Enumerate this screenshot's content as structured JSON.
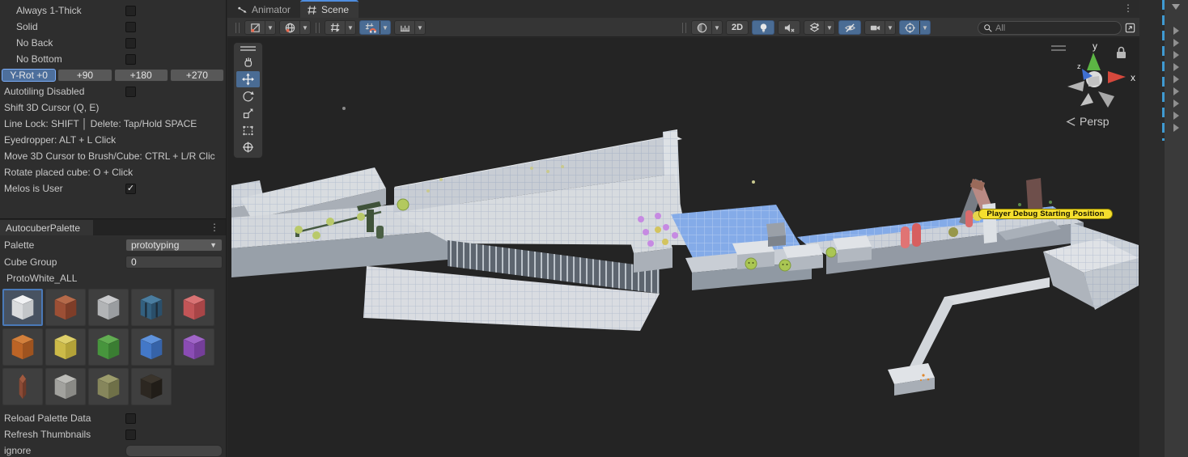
{
  "left_panel": {
    "toggles": [
      {
        "label": "Always 1-Thick",
        "checked": false
      },
      {
        "label": "Solid",
        "checked": false
      },
      {
        "label": "No Back",
        "checked": false
      },
      {
        "label": "No Bottom",
        "checked": false
      }
    ],
    "rotation_buttons": [
      {
        "label": "Y-Rot +0",
        "selected": true
      },
      {
        "label": "+90",
        "selected": false
      },
      {
        "label": "+180",
        "selected": false
      },
      {
        "label": "+270",
        "selected": false
      }
    ],
    "autotiling": {
      "label": "Autotiling Disabled",
      "checked": false
    },
    "hints": [
      "Shift 3D Cursor (Q, E)",
      "Line Lock: SHIFT │ Delete: Tap/Hold SPACE",
      "Eyedropper: ALT + L Click",
      "Move 3D Cursor to Brush/Cube: CTRL + L/R Clic",
      "Rotate placed cube: O + Click"
    ],
    "melos_toggle": {
      "label": "Melos is User",
      "checked": true
    }
  },
  "palette_panel": {
    "title": "AutocuberPalette",
    "rows": [
      {
        "label": "Palette",
        "value": "prototyping"
      },
      {
        "label": "Cube Group",
        "value": "0"
      }
    ],
    "group_name": "ProtoWhite_ALL",
    "swatches": [
      {
        "name": "proto-white",
        "top": "#f1f2f4",
        "left": "#d9dbdd",
        "right": "#c3c6c9",
        "selected": true
      },
      {
        "name": "rust-brown",
        "top": "#b56a4a",
        "left": "#9c4f35",
        "right": "#7e3d28"
      },
      {
        "name": "light-gray",
        "top": "#c9cacc",
        "left": "#b2b4b6",
        "right": "#9a9da0"
      },
      {
        "name": "navy-strapped",
        "top": "#4a7da0",
        "left": "#33607f",
        "right": "#2a4f6a",
        "straps": true
      },
      {
        "name": "red",
        "top": "#d97374",
        "left": "#c25557",
        "right": "#a84547"
      },
      {
        "name": "orange",
        "top": "#d3803c",
        "left": "#bc6426",
        "right": "#9e531f"
      },
      {
        "name": "yellow",
        "top": "#ded06a",
        "left": "#ccba48",
        "right": "#b3a238"
      },
      {
        "name": "green",
        "top": "#62ad52",
        "left": "#47953d",
        "right": "#3a7d32"
      },
      {
        "name": "blue",
        "top": "#5f93dd",
        "left": "#4378c8",
        "right": "#3663a8"
      },
      {
        "name": "purple",
        "top": "#a065c8",
        "left": "#8a4cb4",
        "right": "#743e99"
      },
      {
        "name": "thin-brown-slab",
        "top": "#a05a40",
        "left": "#8a4a35",
        "right": "#6e3a29",
        "variant": "slab"
      },
      {
        "name": "stone-gray",
        "top": "#bcbcb8",
        "left": "#a2a29e",
        "right": "#8a8a86"
      },
      {
        "name": "mossy-bark",
        "top": "#9c9c6c",
        "left": "#86865c",
        "right": "#6f7048"
      },
      {
        "name": "dark-rock",
        "top": "#3a342c",
        "left": "#2c2721",
        "right": "#211d18"
      }
    ],
    "footer": [
      {
        "label": "Reload Palette Data",
        "checked": false
      },
      {
        "label": "Refresh Thumbnails",
        "checked": false
      }
    ],
    "ignore_field": {
      "label": "ignore",
      "value": ""
    }
  },
  "tab_bar": {
    "tabs": [
      {
        "label": "Animator",
        "icon": "animator-icon",
        "active": false
      },
      {
        "label": "Scene",
        "icon": "scene-grid-icon",
        "active": true
      }
    ]
  },
  "toolbar": {
    "view_2d_label": "2D",
    "states": {
      "tool_pivot_active": false,
      "tool_rotation_active": false,
      "grid_visibility_active": false,
      "grid_snap_active": true,
      "increment_snap_active": false,
      "shading_active": false,
      "view_2d_active": false,
      "lighting_active": true,
      "audio_active": false,
      "effects_active": false,
      "hidden_objects_active": true,
      "camera_active": false,
      "gizmos_active": true
    },
    "search": {
      "placeholder": "All"
    }
  },
  "scene_view": {
    "tools": [
      {
        "name": "hand-tool",
        "active": false
      },
      {
        "name": "move-tool",
        "active": true
      },
      {
        "name": "rotate-tool",
        "active": false
      },
      {
        "name": "scale-tool",
        "active": false
      },
      {
        "name": "rect-tool",
        "active": false
      },
      {
        "name": "transform-tool",
        "active": false
      }
    ],
    "gizmo": {
      "axis_x": "x",
      "axis_y": "y",
      "axis_z": "z",
      "projection": "Persp"
    },
    "debug_label": "Player Debug Starting Position",
    "colors": {
      "water": "#84abe8",
      "terrain_light": "#d7dbdf",
      "terrain_shadow": "#9aa1ab",
      "accent_red": "#d96b6b",
      "accent_green": "#a9c653",
      "accent_purple": "#c68ae2",
      "label_bg": "#f5df2e"
    }
  }
}
